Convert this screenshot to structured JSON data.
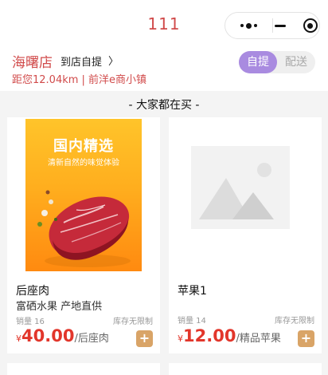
{
  "nav": {
    "title": "111"
  },
  "store": {
    "name": "海曙店",
    "mode": "到店自提",
    "chevron": "〉",
    "address": "距您12.04km | 前洋e商小镇",
    "segments": {
      "pickup": "自提",
      "delivery": "配送"
    }
  },
  "section": {
    "title": "- 大家都在买 -"
  },
  "products": [
    {
      "name": "后座肉",
      "desc": "富硒水果 产地直供",
      "sales": "销量 16",
      "stock": "库存无限制",
      "currency": "¥",
      "price": "40.00",
      "unit": "/后座肉",
      "add": "+",
      "banner_title": "国内精选",
      "banner_subtitle": "清新自然的味觉体验"
    },
    {
      "name": "苹果1",
      "sales": "销量 14",
      "stock": "库存无限制",
      "currency": "¥",
      "price": "12.00",
      "unit": "/精品苹果",
      "add": "+"
    }
  ],
  "colors": {
    "accent": "#d14b4b",
    "toggle": "#a98be0",
    "price": "#e2362b",
    "add_button": "#d9a467"
  }
}
